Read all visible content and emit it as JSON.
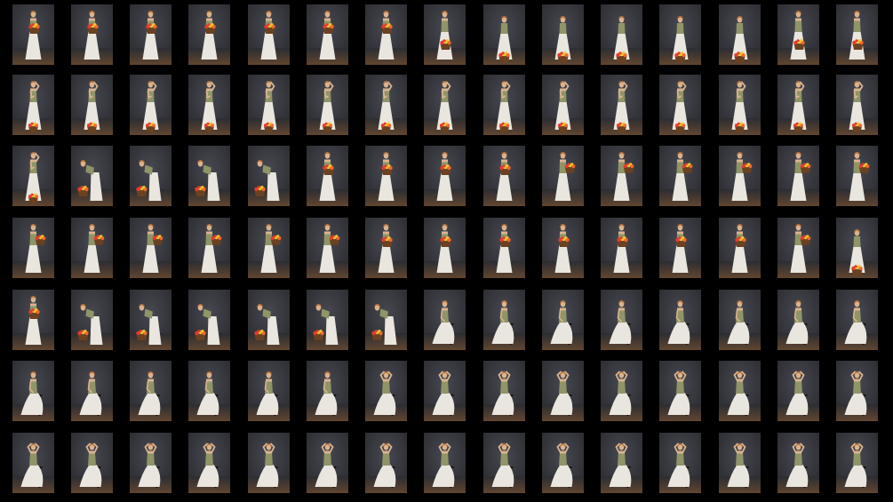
{
  "sheet": {
    "background": "#000000",
    "rows": 7,
    "columns": 15,
    "colors": {
      "backdrop_dark": "#2a2b30",
      "backdrop_light": "#474850",
      "floor_warm": "#6e4c30",
      "skin": "#d9b48f",
      "hair": "#b0703c",
      "dress": "#e9e6df",
      "bodice": "#8f9567",
      "basket": "#6b4121",
      "flowers": [
        "#e23b2f",
        "#f2c32e",
        "#ef6a2a"
      ],
      "stool": "#1a120c"
    }
  },
  "thumbnails": [
    [
      "stand-basket",
      "stand-basket",
      "stand-basket",
      "stand-basket",
      "stand-basket",
      "stand-basket",
      "stand-basket",
      "stand-basket-low",
      "bend-basket",
      "bend-basket",
      "bend-basket",
      "bend-basket",
      "bend-basket",
      "stand-basket-low",
      "stand-basket-low"
    ],
    [
      "stand-arm-up",
      "stand-arm-up",
      "stand-arm-up",
      "stand-arm-up",
      "stand-arm-up",
      "stand-arm-up",
      "stand-arm-up",
      "stand-arm-up",
      "stand-arm-up",
      "stand-arm-up",
      "stand-arm-up",
      "stand-arm-up",
      "stand-arm-up",
      "stand-arm-up",
      "stand-arm-up"
    ],
    [
      "stand-arm-up",
      "bend-deep",
      "bend-deep",
      "bend-deep",
      "bend-deep",
      "stand-basket-front",
      "stand-basket-front",
      "stand-basket-front",
      "stand-basket-front",
      "stand-basket-side",
      "stand-basket-side",
      "stand-basket-side",
      "stand-basket-side",
      "stand-basket-side",
      "stand-basket-side"
    ],
    [
      "stand-basket-side",
      "stand-basket-side",
      "stand-basket-side",
      "stand-basket-side",
      "stand-basket-side",
      "stand-basket-side",
      "stand-basket-front",
      "stand-basket-front",
      "stand-basket-front",
      "stand-basket-front",
      "stand-basket-front",
      "stand-basket-front",
      "stand-basket-front",
      "stand-basket-side",
      "bend-basket"
    ],
    [
      "stand-basket-front",
      "bend-deep",
      "bend-deep",
      "bend-deep",
      "bend-deep",
      "bend-deep",
      "bend-deep",
      "seated-side",
      "seated-side",
      "seated-side",
      "seated-side",
      "seated-side",
      "seated-side",
      "seated-side",
      "seated-side"
    ],
    [
      "seated-front",
      "seated-front",
      "seated-front",
      "seated-front",
      "seated-front",
      "seated-front",
      "seated-arms-up",
      "seated-arms-up",
      "seated-arms-up",
      "seated-arms-up",
      "seated-arms-up",
      "seated-arms-up",
      "seated-arms-up",
      "seated-arms-up",
      "seated-arms-up"
    ],
    [
      "seated-arms-up",
      "seated-arms-up",
      "seated-arms-up",
      "seated-arms-up",
      "seated-arms-up",
      "seated-arms-up",
      "seated-arms-up",
      "seated-arms-up",
      "seated-arms-up",
      "seated-arms-up",
      "seated-arms-up",
      "seated-arms-up",
      "seated-arms-up",
      "seated-arms-up",
      "seated-arms-up"
    ]
  ]
}
